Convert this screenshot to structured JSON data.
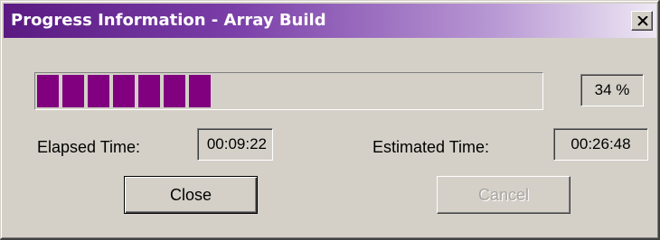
{
  "window": {
    "title": "Progress Information - Array Build"
  },
  "progress": {
    "percent_label": "34 %",
    "fraction": 0.34,
    "segment_color": "#800080",
    "segment_count": 7
  },
  "elapsed": {
    "label": "Elapsed Time:",
    "value": "00:09:22"
  },
  "estimated": {
    "label": "Estimated Time:",
    "value": "00:26:48"
  },
  "buttons": {
    "close_label": "Close",
    "cancel_label": "Cancel",
    "cancel_enabled": false
  },
  "icons": {
    "titlebar_close": "close-icon"
  }
}
